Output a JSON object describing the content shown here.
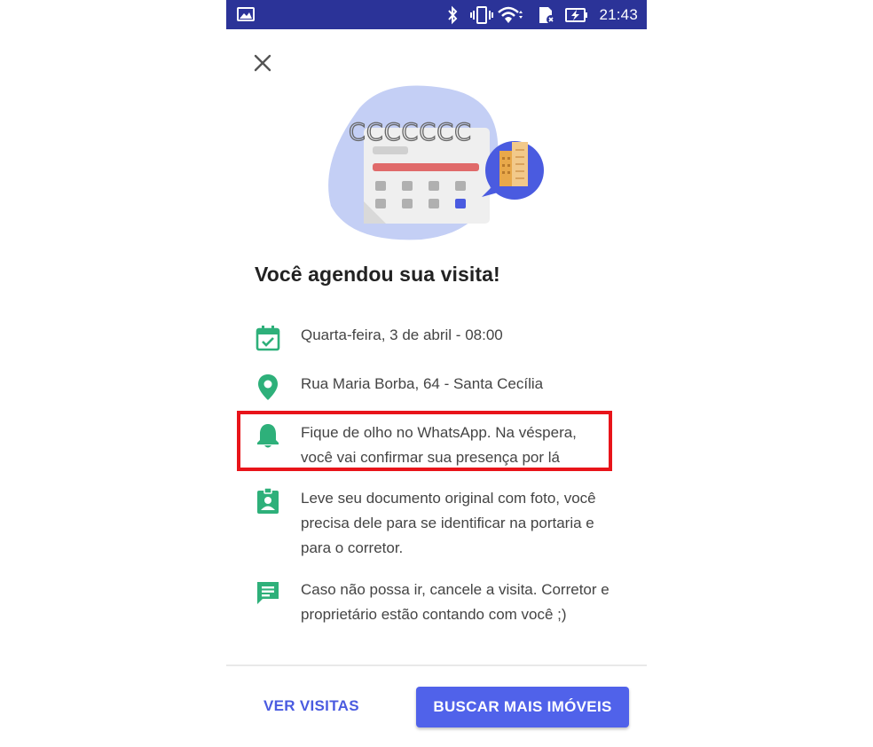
{
  "status_bar": {
    "time": "21:43",
    "icons": [
      "image-icon",
      "bluetooth-icon",
      "vibrate-icon",
      "wifi-icon",
      "sd-card-icon",
      "battery-charging-icon"
    ]
  },
  "header": {
    "close_icon": "close-icon"
  },
  "illustration": {
    "icon": "calendar-building-illustration",
    "spiral_text": "CCCCCCC"
  },
  "title": "Você agendou sua visita!",
  "items": [
    {
      "icon": "calendar-check-icon",
      "text": "Quarta-feira, 3 de abril - 08:00"
    },
    {
      "icon": "location-pin-icon",
      "text": "Rua Maria Borba, 64 - Santa Cecília"
    },
    {
      "icon": "bell-icon",
      "text": "Fique de olho no WhatsApp. Na véspera, você vai confirmar sua presença por lá"
    },
    {
      "icon": "id-badge-icon",
      "text": "Leve seu documento original com foto, você precisa dele para se identificar na portaria e para o corretor."
    },
    {
      "icon": "chat-icon",
      "text": "Caso não possa ir, cancele a visita. Corretor e proprietário estão contando com você ;)"
    }
  ],
  "footer": {
    "secondary_button": "VER VISITAS",
    "primary_button": "BUSCAR MAIS IMÓVEIS"
  },
  "colors": {
    "status_bar": "#2b3398",
    "accent": "#5062ea",
    "icon_green": "#2eb07a",
    "highlight_border": "#e8141a"
  }
}
